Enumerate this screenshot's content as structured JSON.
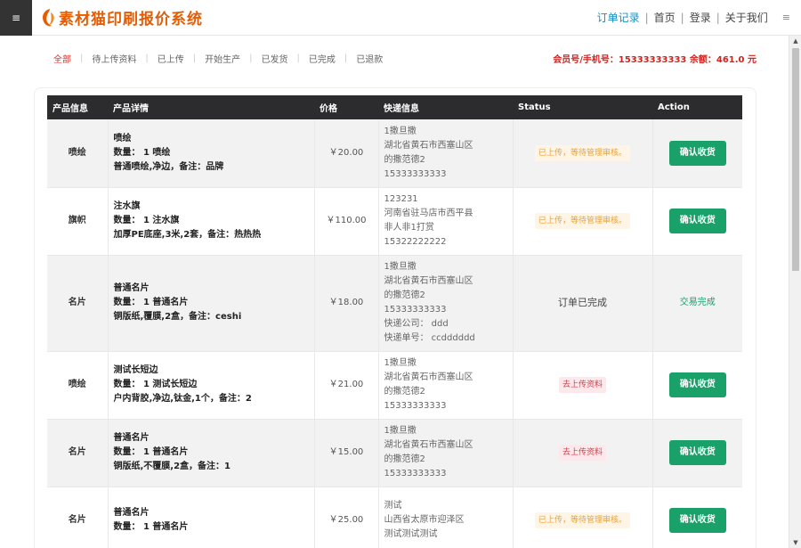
{
  "header": {
    "menu_icon": "≡",
    "logo_text": "素材猫印刷报价系统",
    "nav": [
      "订单记录",
      "首页",
      "登录",
      "关于我们"
    ],
    "right_icon": "≡"
  },
  "filters": {
    "tabs": [
      "全部",
      "待上传资料",
      "已上传",
      "开始生产",
      "已发货",
      "已完成",
      "已退款"
    ],
    "member_info": "会员号/手机号：15333333333 余额：461.0 元"
  },
  "table": {
    "headers": [
      "产品信息",
      "产品详情",
      "价格",
      "快递信息",
      "Status",
      "Action"
    ],
    "rows": [
      {
        "type": "喷绘",
        "detail": [
          "喷绘",
          "数量： 1 喷绘",
          "普通喷绘,净边，备注：品牌"
        ],
        "price": "￥20.00",
        "address": [
          "1撒旦撒",
          "湖北省黄石市西塞山区",
          "的撒范德2",
          "15333333333"
        ],
        "status": "已上传，等待管理审核。",
        "action": "确认收货"
      },
      {
        "type": "旗帜",
        "detail": [
          "注水旗",
          "数量： 1 注水旗",
          "加厚PE底座,3米,2套，备注：热热热"
        ],
        "price": "￥110.00",
        "address": [
          "123231",
          "河南省驻马店市西平县",
          "非人非1打赏",
          "15322222222"
        ],
        "status": "已上传，等待管理审核。",
        "action": "确认收货"
      },
      {
        "type": "名片",
        "detail": [
          "普通名片",
          "数量： 1 普通名片",
          "铜版纸,覆膜,2盒，备注：ceshi"
        ],
        "price": "￥18.00",
        "address": [
          "1撒旦撒",
          "湖北省黄石市西塞山区",
          "的撒范德2",
          "15333333333",
          "快递公司： ddd",
          "快递单号： ccdddddd"
        ],
        "status": "订单已完成",
        "action": "交易完成"
      },
      {
        "type": "喷绘",
        "detail": [
          "测试长短边",
          "数量： 1 测试长短边",
          "户内背胶,净边,钛金,1个，备注：2"
        ],
        "price": "￥21.00",
        "address": [
          "1撒旦撒",
          "湖北省黄石市西塞山区",
          "的撒范德2",
          "15333333333"
        ],
        "status": "去上传资料",
        "action": "确认收货"
      },
      {
        "type": "名片",
        "detail": [
          "普通名片",
          "数量： 1 普通名片",
          "铜版纸,不覆膜,2盒，备注：1"
        ],
        "price": "￥15.00",
        "address": [
          "1撒旦撒",
          "湖北省黄石市西塞山区",
          "的撒范德2",
          "15333333333"
        ],
        "status": "去上传资料",
        "action": "确认收货"
      },
      {
        "type": "名片",
        "detail": [
          "普通名片",
          "数量： 1 普通名片"
        ],
        "price": "￥25.00",
        "address": [
          "测试",
          "山西省太原市迎泽区",
          "测试测试测试"
        ],
        "status": "已上传，等待管理审核。",
        "action": "确认收货"
      }
    ]
  },
  "colors": {
    "accent_red": "#e0312c",
    "logo_orange": "#e65c00",
    "header_dark": "#2c2c2e",
    "button_green": "#1aa16a",
    "nav_active": "#1a8fbf"
  }
}
